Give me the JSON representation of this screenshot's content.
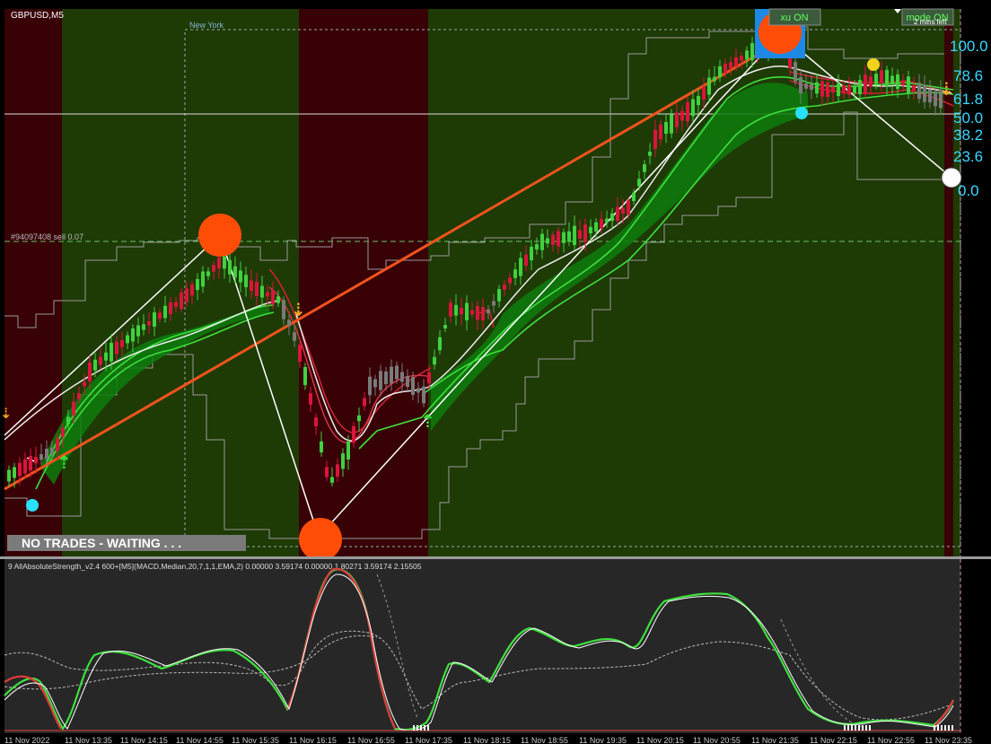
{
  "symbol_title": "GBPUSD,M5",
  "session_label": "New York",
  "order_line_label": "#94097408 sell 0.07",
  "status_banner": "NO TRADES - WAITING . . .",
  "buttons": {
    "xu": "xu ON",
    "mode": "mode ON",
    "timer": "2 mins left"
  },
  "fib_levels": [
    "100.0",
    "78.6",
    "61.8",
    "50.0",
    "38.2",
    "23.6",
    "0.0"
  ],
  "indicator_title": "9 AllAbsoluteStrength_v2.4 600+[M5](MACD,Median,20,7,1,1,EMA,2) 0.00000 3.59174 0.00000 1.80271 3.59174 2.15505",
  "time_axis": [
    "11 Nov 2022",
    "11 Nov 13:35",
    "11 Nov 14:15",
    "11 Nov 14:55",
    "11 Nov 15:35",
    "11 Nov 16:15",
    "11 Nov 16:55",
    "11 Nov 17:35",
    "11 Nov 18:15",
    "11 Nov 18:55",
    "11 Nov 19:35",
    "11 Nov 20:15",
    "11 Nov 20:55",
    "11 Nov 21:35",
    "11 Nov 22:15",
    "11 Nov 22:55",
    "11 Nov 23:35"
  ],
  "colors": {
    "bg_green": "#1e3a05",
    "bg_red": "#370106",
    "bull_candle": "#3fd13f",
    "bear_candle": "#dc143c",
    "neutral_candle": "#7a7a7a",
    "trend_line": "#f0531c",
    "fib_text": "#38d8ff",
    "signal_dot": "#ff4d08"
  },
  "icons": [
    "arrow-down-icon",
    "arrow-up-icon",
    "signal-dot-icon"
  ]
}
